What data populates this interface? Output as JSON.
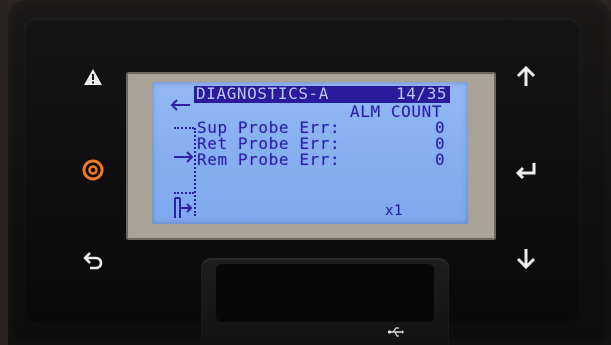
{
  "screen": {
    "title": "DIAGNOSTICS-A",
    "page": "14/35",
    "column_header": "ALM COUNT",
    "rows": [
      {
        "label": "Sup Probe Err:",
        "value": "0"
      },
      {
        "label": "Ret Probe Err:",
        "value": "0"
      },
      {
        "label": "Rem Probe Err:",
        "value": "0"
      }
    ],
    "multiplier": "x1"
  },
  "buttons": {
    "alarm": "warning-triangle",
    "home": "circle-target",
    "back": "return-arrow",
    "up": "up-arrow",
    "enter": "enter-arrow",
    "down": "down-arrow"
  },
  "colors": {
    "lcd_background": "#86aff1",
    "lcd_text": "#2f1fa8",
    "title_bar": "#2b1a9b",
    "home_button": "#f07a22",
    "panel": "#111111"
  }
}
